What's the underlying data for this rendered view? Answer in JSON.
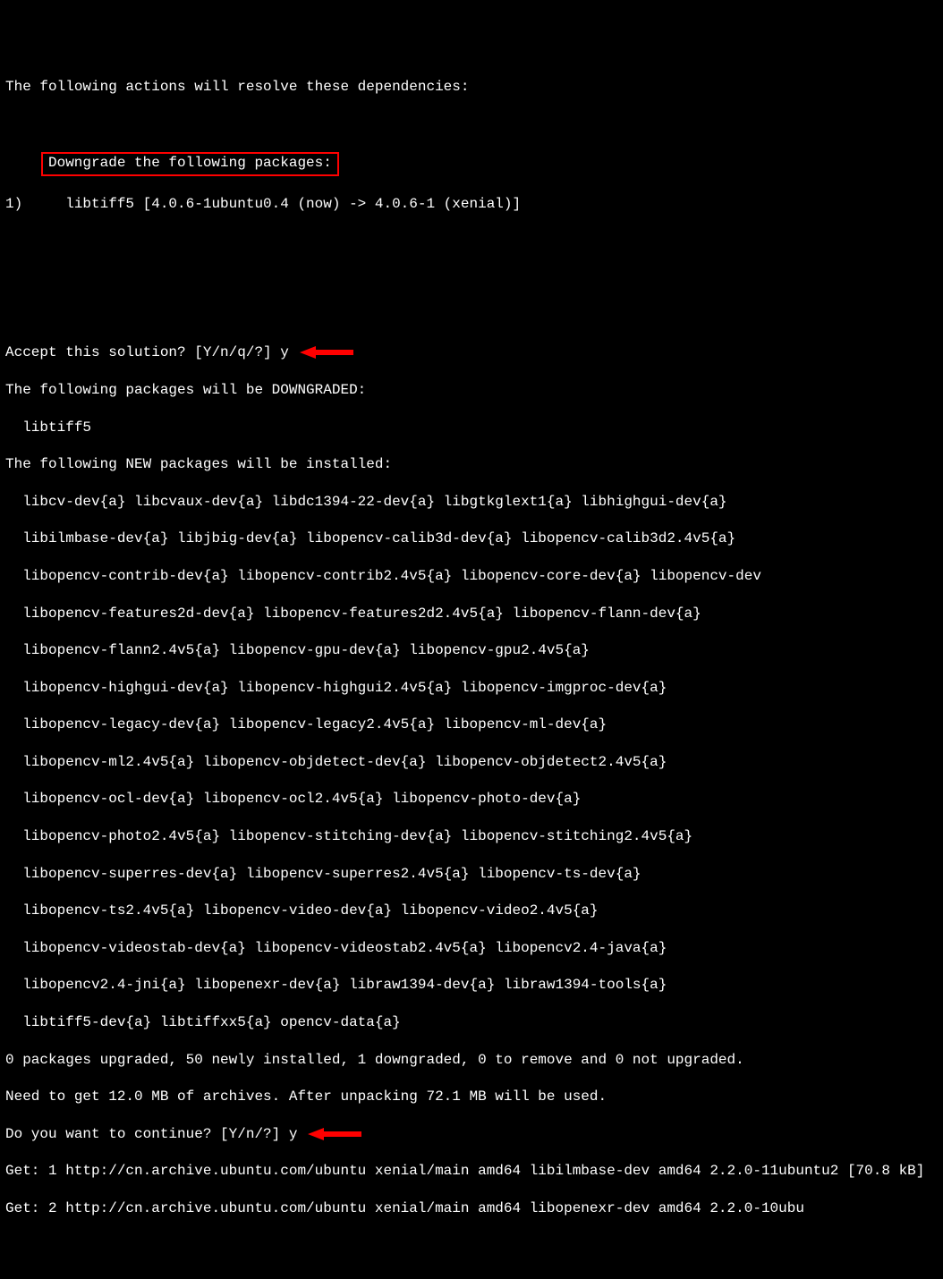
{
  "header": {
    "resolve_line": "The following actions will resolve these dependencies:",
    "downgrade_header": "Downgrade the following packages:",
    "downgrade_line": "1)     libtiff5 [4.0.6-1ubuntu0.4 (now) -> 4.0.6-1 (xenial)]"
  },
  "prompts": {
    "accept_solution": "Accept this solution? [Y/n/q/?] y",
    "continue_prompt": "Do you want to continue? [Y/n/?] y"
  },
  "sections": {
    "downgraded_header": "The following packages will be DOWNGRADED:",
    "downgraded_pkgs": "  libtiff5",
    "new_header": "The following NEW packages will be installed:",
    "pkglines": [
      "  libcv-dev{a} libcvaux-dev{a} libdc1394-22-dev{a} libgtkglext1{a} libhighgui-dev{a}",
      "  libilmbase-dev{a} libjbig-dev{a} libopencv-calib3d-dev{a} libopencv-calib3d2.4v5{a}",
      "  libopencv-contrib-dev{a} libopencv-contrib2.4v5{a} libopencv-core-dev{a} libopencv-dev",
      "  libopencv-features2d-dev{a} libopencv-features2d2.4v5{a} libopencv-flann-dev{a}",
      "  libopencv-flann2.4v5{a} libopencv-gpu-dev{a} libopencv-gpu2.4v5{a}",
      "  libopencv-highgui-dev{a} libopencv-highgui2.4v5{a} libopencv-imgproc-dev{a}",
      "  libopencv-legacy-dev{a} libopencv-legacy2.4v5{a} libopencv-ml-dev{a}",
      "  libopencv-ml2.4v5{a} libopencv-objdetect-dev{a} libopencv-objdetect2.4v5{a}",
      "  libopencv-ocl-dev{a} libopencv-ocl2.4v5{a} libopencv-photo-dev{a}",
      "  libopencv-photo2.4v5{a} libopencv-stitching-dev{a} libopencv-stitching2.4v5{a}",
      "  libopencv-superres-dev{a} libopencv-superres2.4v5{a} libopencv-ts-dev{a}",
      "  libopencv-ts2.4v5{a} libopencv-video-dev{a} libopencv-video2.4v5{a}",
      "  libopencv-videostab-dev{a} libopencv-videostab2.4v5{a} libopencv2.4-java{a}",
      "  libopencv2.4-jni{a} libopenexr-dev{a} libraw1394-dev{a} libraw1394-tools{a}",
      "  libtiff5-dev{a} libtiffxx5{a} opencv-data{a}"
    ]
  },
  "summary": {
    "counts": "0 packages upgraded, 50 newly installed, 1 downgraded, 0 to remove and 0 not upgraded.",
    "need_to_get": "Need to get 12.0 MB of archives. After unpacking 72.1 MB will be used."
  },
  "downloads": [
    "Get: 1 http://cn.archive.ubuntu.com/ubuntu xenial/main amd64 libilmbase-dev amd64 2.2.0-11ubuntu2 [70.8 kB]",
    "Get: 2 http://cn.archive.ubuntu.com/ubuntu xenial/main amd64 libopenexr-dev amd64 2.2.0-10ubu"
  ],
  "colors": {
    "highlight_border": "#ff0000",
    "arrow_fill": "#ff0000"
  }
}
